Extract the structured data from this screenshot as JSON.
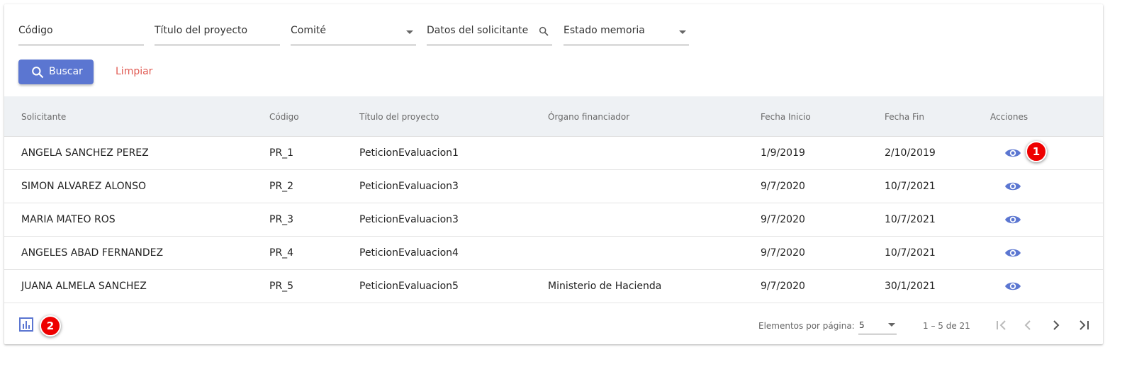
{
  "filters": {
    "codigo": "Código",
    "titulo": "Título del proyecto",
    "comite": "Comité",
    "solicitante": "Datos del solicitante",
    "estado": "Estado memoria"
  },
  "buttons": {
    "search": "Buscar",
    "clear": "Limpiar"
  },
  "table": {
    "headers": {
      "solicitante": "Solicitante",
      "codigo": "Código",
      "titulo": "Título del proyecto",
      "organo": "Órgano financiador",
      "inicio": "Fecha Inicio",
      "fin": "Fecha Fin",
      "acciones": "Acciones"
    },
    "rows": [
      {
        "solicitante": "ANGELA SANCHEZ PEREZ",
        "codigo": "PR_1",
        "titulo": "PeticionEvaluacion1",
        "organo": "",
        "inicio": "1/9/2019",
        "fin": "2/10/2019"
      },
      {
        "solicitante": "SIMON ALVAREZ ALONSO",
        "codigo": "PR_2",
        "titulo": "PeticionEvaluacion3",
        "organo": "",
        "inicio": "9/7/2020",
        "fin": "10/7/2021"
      },
      {
        "solicitante": "MARIA MATEO ROS",
        "codigo": "PR_3",
        "titulo": "PeticionEvaluacion3",
        "organo": "",
        "inicio": "9/7/2020",
        "fin": "10/7/2021"
      },
      {
        "solicitante": "ANGELES ABAD FERNANDEZ",
        "codigo": "PR_4",
        "titulo": "PeticionEvaluacion4",
        "organo": "",
        "inicio": "9/7/2020",
        "fin": "10/7/2021"
      },
      {
        "solicitante": "JUANA ALMELA SANCHEZ",
        "codigo": "PR_5",
        "titulo": "PeticionEvaluacion5",
        "organo": "Ministerio de Hacienda",
        "inicio": "9/7/2020",
        "fin": "30/1/2021"
      }
    ]
  },
  "badges": {
    "one": "1",
    "two": "2"
  },
  "paginator": {
    "label": "Elementos por página:",
    "page_size": "5",
    "range": "1 – 5 de 21"
  },
  "colors": {
    "accent": "#5b76d1",
    "clear": "#e05a52",
    "header_bg": "#eef1f4",
    "badge": "#e00000"
  },
  "icons": {
    "search": "search-icon",
    "view": "eye-icon",
    "chart": "bar-chart-icon",
    "first": "first-page-icon",
    "prev": "chevron-left-icon",
    "next": "chevron-right-icon",
    "last": "last-page-icon"
  }
}
